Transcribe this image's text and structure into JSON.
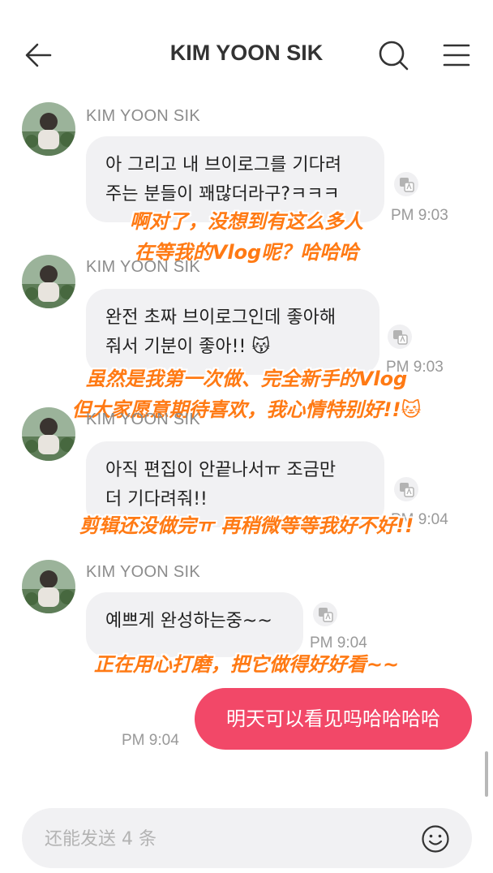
{
  "header": {
    "title": "KIM YOON SIK"
  },
  "messages": [
    {
      "sender": "KIM YOON SIK",
      "text_lines": [
        "아 그리고 내 브이로그를 기다려",
        "주는 분들이 꽤많더라구?ㅋㅋㅋ"
      ],
      "time": "PM 9:03",
      "caption_lines": [
        "啊对了，没想到有这么多人",
        "在等我的Vlog呢？哈哈哈"
      ]
    },
    {
      "sender": "KIM YOON SIK",
      "text_lines": [
        "완전 초짜 브이로그인데 좋아해",
        "줘서 기분이 좋아!! 😽"
      ],
      "time": "PM 9:03",
      "caption_lines": [
        "虽然是我第一次做、完全新手的Vlog",
        "但大家愿意期待喜欢，我心情特别好!!🐱"
      ]
    },
    {
      "sender": "KIM YOON SIK",
      "text_lines": [
        "아직 편집이 안끝나서ㅠ 조금만",
        "더 기다려줘!!"
      ],
      "time": "PM 9:04",
      "caption_lines": [
        "剪辑还没做完ㅠ 再稍微等等我好不好!!"
      ]
    },
    {
      "sender": "KIM YOON SIK",
      "text_lines": [
        "예쁘게 완성하는중~~"
      ],
      "time": "PM 9:04",
      "caption_lines": [
        "正在用心打磨，把它做得好好看~~"
      ]
    }
  ],
  "my_message": {
    "text": "明天可以看见吗哈哈哈哈",
    "time": "PM 9:04"
  },
  "input": {
    "placeholder": "还能发送 4 条"
  },
  "icons": {
    "back": "arrow-left-icon",
    "search": "search-icon",
    "menu": "hamburger-menu-icon",
    "translate": "translate-icon",
    "emoji": "smiley-icon"
  },
  "colors": {
    "accent": "#f24868",
    "bubble": "#f1f1f3",
    "caption": "#ff7a14",
    "meta": "#999999"
  }
}
